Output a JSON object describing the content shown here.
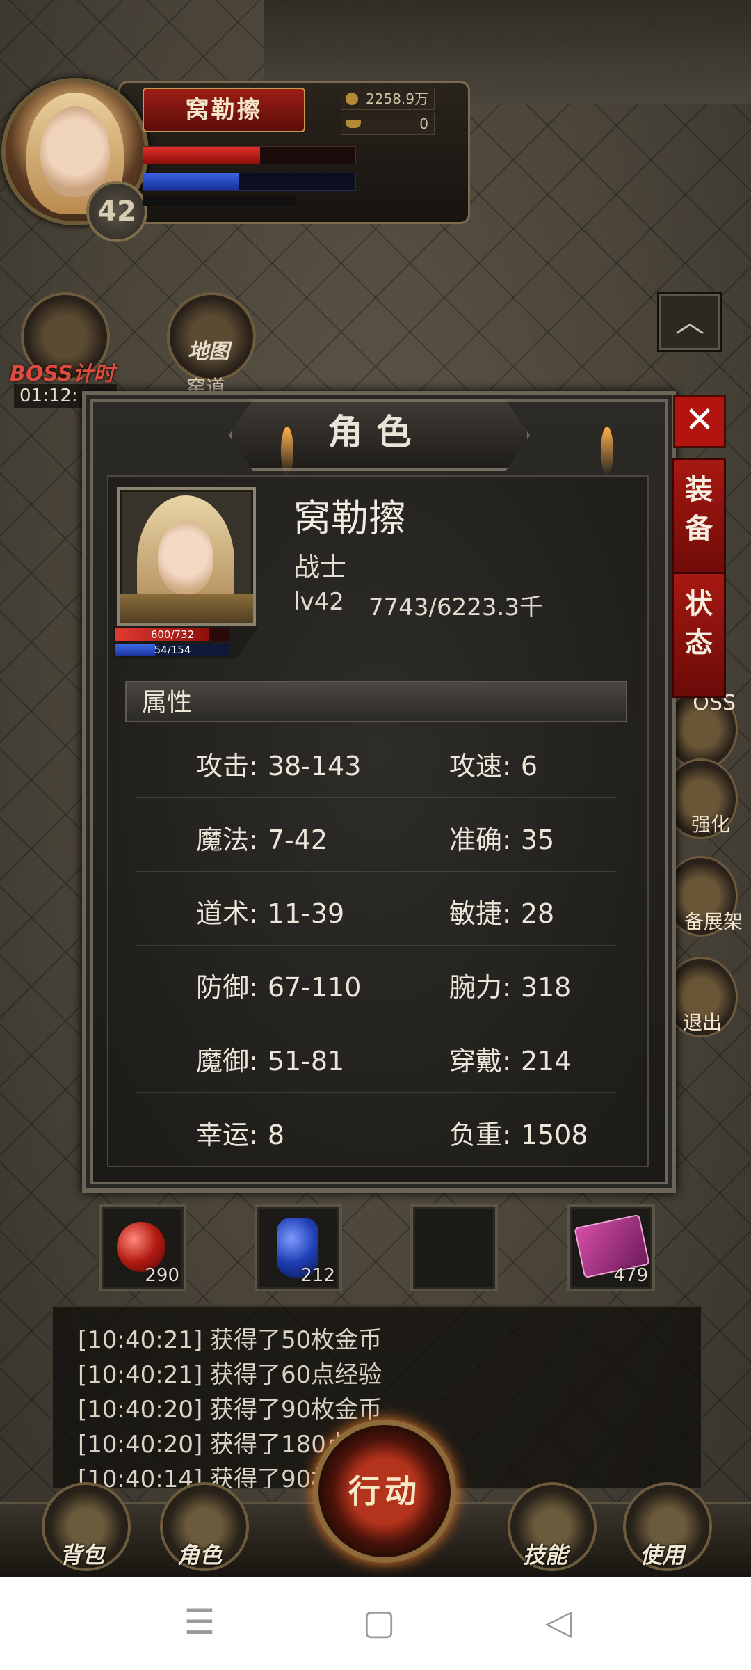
{
  "hud": {
    "player_name": "窝勒擦",
    "gold": "2258.9万",
    "ingot": "0",
    "level": "42",
    "hp_fraction": 0.55,
    "mp_fraction": 0.45
  },
  "side": {
    "boss_label": "BOSS计时",
    "boss_timer": "01:12:",
    "map_label": "地图",
    "map_sub": "窑道"
  },
  "right_icons": {
    "boss": "OSS",
    "strengthen": "强化",
    "equip_rack": "备展架",
    "exit": "退出"
  },
  "modal": {
    "title": "角色",
    "close": "✕",
    "tab_equip": "装备",
    "tab_status": "状态",
    "name": "窝勒擦",
    "class": "战士",
    "level": "lv42",
    "exp": "7743/6223.3千",
    "hp": "600/732",
    "mp": "54/154",
    "hp_fraction": 0.82,
    "mp_fraction": 0.35,
    "section": "属性",
    "attributes": [
      {
        "lk": "攻击:",
        "lv": "38-143",
        "rk": "攻速:",
        "rv": "6"
      },
      {
        "lk": "魔法:",
        "lv": "7-42",
        "rk": "准确:",
        "rv": "35"
      },
      {
        "lk": "道术:",
        "lv": "11-39",
        "rk": "敏捷:",
        "rv": "28"
      },
      {
        "lk": "防御:",
        "lv": "67-110",
        "rk": "腕力:",
        "rv": "318"
      },
      {
        "lk": "魔御:",
        "lv": "51-81",
        "rk": "穿戴:",
        "rv": "214"
      },
      {
        "lk": "幸运:",
        "lv": "8",
        "rk": "负重:",
        "rv": "1508"
      }
    ]
  },
  "slots": [
    {
      "icon": "red-potion-icon",
      "count": "290"
    },
    {
      "icon": "blue-potion-icon",
      "count": "212"
    },
    {
      "icon": "empty",
      "count": ""
    },
    {
      "icon": "scroll-icon",
      "count": "479"
    }
  ],
  "chat": [
    "[10:40:21] 获得了50枚金币",
    "[10:40:21] 获得了60点经验",
    "[10:40:20] 获得了90枚金币",
    "[10:40:20] 获得了180点经",
    "[10:40:14] 获得了90枚"
  ],
  "bottom": {
    "bag": "背包",
    "role": "角色",
    "action": "行动",
    "skill": "技能",
    "use": "使用"
  },
  "nav": {
    "menu": "☰",
    "home": "▢",
    "back": "◁"
  }
}
